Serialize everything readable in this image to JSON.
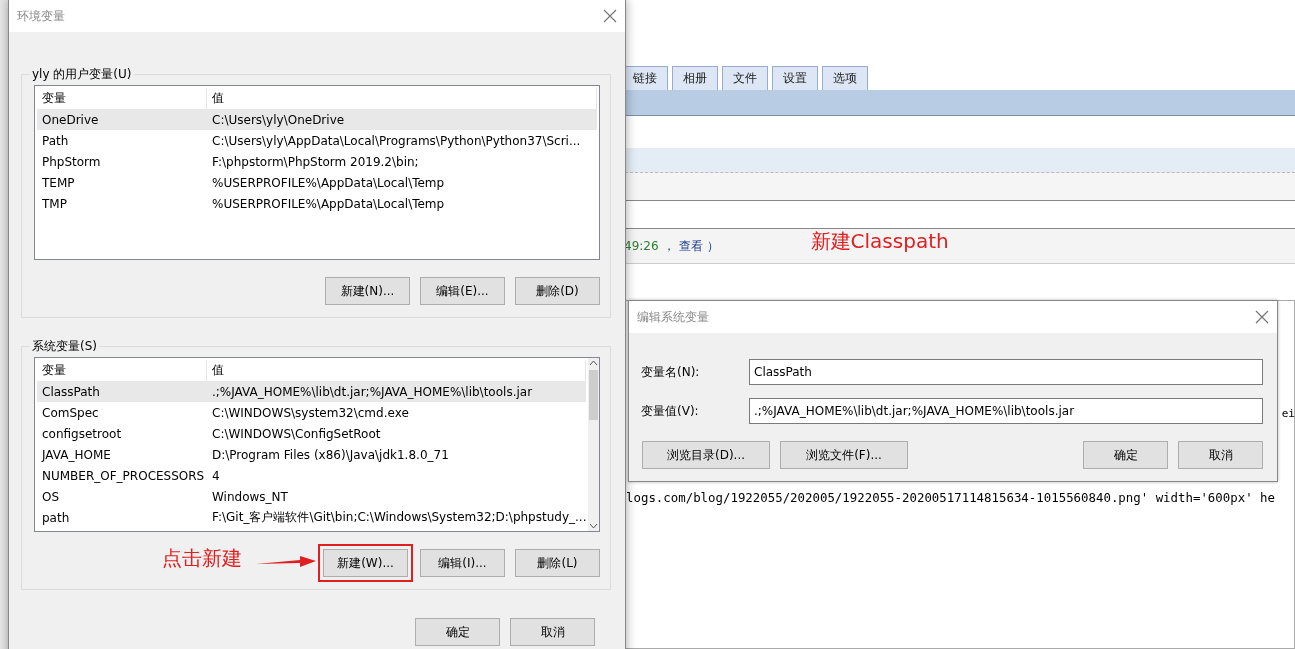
{
  "background_page": {
    "tabs": [
      {
        "label": "链接"
      },
      {
        "label": "相册"
      },
      {
        "label": "文件"
      },
      {
        "label": "设置"
      },
      {
        "label": "选项"
      }
    ],
    "comment_meta": {
      "time": "49:26",
      "separator": "，",
      "link": "查看",
      "paren": "）"
    },
    "annotation": "新建Classpath",
    "edge_text": "ei",
    "code_line": "logs.com/blog/1922055/202005/1922055-20200517114815634-1015560840.png' width='600px' he"
  },
  "env_dialog": {
    "title": "环境变量",
    "user_vars": {
      "label": "yly 的用户变量(U)",
      "columns": [
        "变量",
        "值"
      ],
      "rows": [
        {
          "name": "OneDrive",
          "value": "C:\\Users\\yly\\OneDrive",
          "selected": true
        },
        {
          "name": "Path",
          "value": "C:\\Users\\yly\\AppData\\Local\\Programs\\Python\\Python37\\Scri...",
          "selected": false
        },
        {
          "name": "PhpStorm",
          "value": "F:\\phpstorm\\PhpStorm 2019.2\\bin;",
          "selected": false
        },
        {
          "name": "TEMP",
          "value": "%USERPROFILE%\\AppData\\Local\\Temp",
          "selected": false
        },
        {
          "name": "TMP",
          "value": "%USERPROFILE%\\AppData\\Local\\Temp",
          "selected": false
        }
      ],
      "buttons": [
        {
          "label": "新建(N)...",
          "highlighted": false
        },
        {
          "label": "编辑(E)...",
          "highlighted": false
        },
        {
          "label": "删除(D)",
          "highlighted": false
        }
      ]
    },
    "system_vars": {
      "label": "系统变量(S)",
      "columns": [
        "变量",
        "值"
      ],
      "rows": [
        {
          "name": "ClassPath",
          "value": ".;%JAVA_HOME%\\lib\\dt.jar;%JAVA_HOME%\\lib\\tools.jar",
          "selected": true
        },
        {
          "name": "ComSpec",
          "value": "C:\\WINDOWS\\system32\\cmd.exe",
          "selected": false
        },
        {
          "name": "configsetroot",
          "value": "C:\\WINDOWS\\ConfigSetRoot",
          "selected": false
        },
        {
          "name": "JAVA_HOME",
          "value": "D:\\Program Files (x86)\\Java\\jdk1.8.0_71",
          "selected": false
        },
        {
          "name": "NUMBER_OF_PROCESSORS",
          "value": "4",
          "selected": false
        },
        {
          "name": "OS",
          "value": "Windows_NT",
          "selected": false
        },
        {
          "name": "path",
          "value": "F:\\Git_客户端软件\\Git\\bin;C:\\Windows\\System32;D:\\phpstudy_...",
          "selected": false
        }
      ],
      "buttons": [
        {
          "label": "新建(W)...",
          "highlighted": true
        },
        {
          "label": "编辑(I)...",
          "highlighted": false
        },
        {
          "label": "删除(L)",
          "highlighted": false
        }
      ]
    },
    "annotation": "点击新建",
    "footer_buttons": [
      "确定",
      "取消"
    ]
  },
  "edit_dialog": {
    "title": "编辑系统变量",
    "fields": [
      {
        "label": "变量名(N):",
        "value": "ClassPath"
      },
      {
        "label": "变量值(V):",
        "value": ".;%JAVA_HOME%\\lib\\dt.jar;%JAVA_HOME%\\lib\\tools.jar"
      }
    ],
    "browse_buttons": [
      "浏览目录(D)...",
      "浏览文件(F)..."
    ],
    "buttons": [
      "确定",
      "取消"
    ]
  }
}
